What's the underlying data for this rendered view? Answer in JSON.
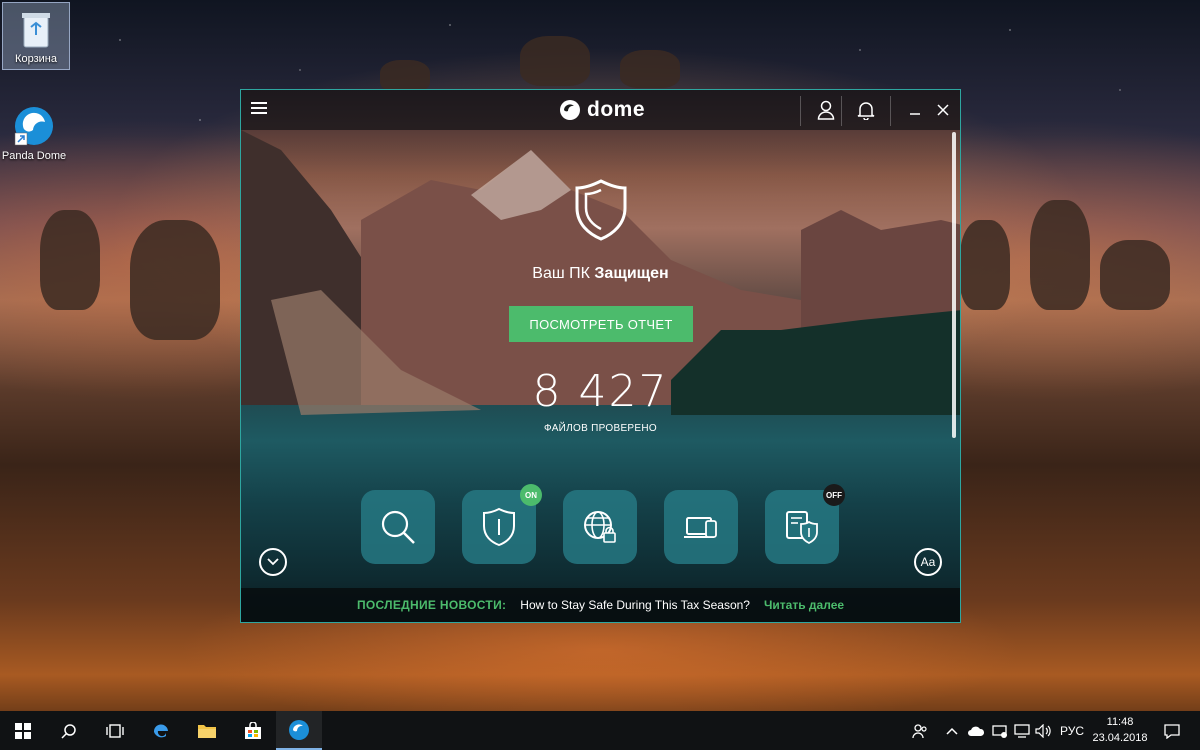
{
  "desktop": {
    "icons": [
      {
        "label": "Корзина",
        "icon": "recycle-bin-icon"
      },
      {
        "label": "Panda Dome",
        "icon": "panda-dome-icon"
      }
    ]
  },
  "app": {
    "logo_text": "dome",
    "status_prefix": "Ваш ПК",
    "status_value": "Защищен",
    "report_button": "ПОСМОТРЕТЬ ОТЧЕТ",
    "files_checked": "8 427",
    "files_label": "ФАЙЛОВ ПРОВЕРЕНО",
    "features": [
      {
        "name": "scan",
        "icon": "search-icon"
      },
      {
        "name": "antivirus",
        "icon": "shield-icon",
        "badge": "ON"
      },
      {
        "name": "web-protection",
        "icon": "globe-lock-icon"
      },
      {
        "name": "devices",
        "icon": "devices-icon"
      },
      {
        "name": "data-shield",
        "icon": "document-shield-icon",
        "badge": "OFF"
      }
    ],
    "font_button": "Aa",
    "news": {
      "label": "ПОСЛЕДНИЕ НОВОСТИ:",
      "headline": "How to Stay Safe During This Tax Season?",
      "more": "Читать далее"
    },
    "colors": {
      "accent": "#4cbb6c",
      "tile": "#267882",
      "border": "#2ea6a0"
    }
  },
  "taskbar": {
    "language": "РУС",
    "time": "11:48",
    "date": "23.04.2018"
  }
}
